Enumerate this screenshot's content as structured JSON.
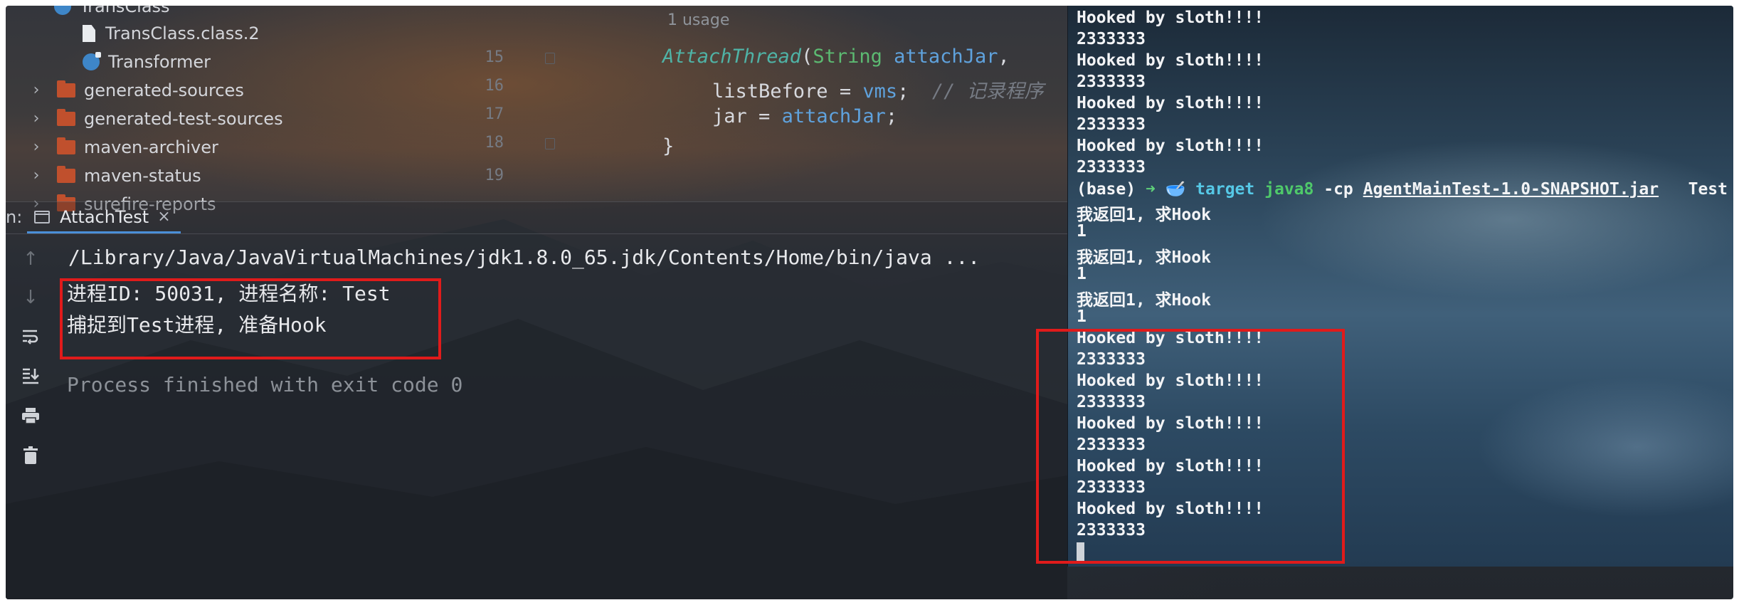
{
  "project_tree": {
    "items": [
      {
        "label": "TransClass",
        "kind": "class"
      },
      {
        "label": "TransClass.class.2",
        "kind": "file"
      },
      {
        "label": "Transformer",
        "kind": "class"
      },
      {
        "label": "generated-sources",
        "kind": "folder"
      },
      {
        "label": "generated-test-sources",
        "kind": "folder"
      },
      {
        "label": "maven-archiver",
        "kind": "folder"
      },
      {
        "label": "maven-status",
        "kind": "folder"
      },
      {
        "label": "surefire-reports",
        "kind": "folder"
      }
    ]
  },
  "editor": {
    "usage_hint": "1 usage",
    "line_numbers": [
      "15",
      "16",
      "17",
      "18",
      "19"
    ],
    "lines": {
      "l15": {
        "method": "AttachThread",
        "open": "(",
        "type": "String",
        "param": "attachJar",
        "tail": ","
      },
      "l16": {
        "var": "listBefore",
        "eq": " = ",
        "value": "vms",
        "semi": ";",
        "comment": "// 记录程序"
      },
      "l17": {
        "var": "jar",
        "eq": " = ",
        "value": "attachJar",
        "semi": ";"
      },
      "l18": {
        "text": "}"
      }
    }
  },
  "run_window": {
    "label": "n:",
    "tab_label": "AttachTest",
    "console": {
      "command": "/Library/Java/JavaVirtualMachines/jdk1.8.0_65.jdk/Contents/Home/bin/java ...",
      "lines": [
        "进程ID: 50031, 进程名称: Test",
        "捕捉到Test进程, 准备Hook"
      ],
      "exit_message": "Process finished with exit code 0"
    },
    "toolbar_icons": [
      "arrow-up-icon",
      "arrow-down-icon",
      "soft-wrap-icon",
      "scroll-to-end-icon",
      "print-icon",
      "trash-icon"
    ]
  },
  "terminal": {
    "lines_before": [
      "Hooked by sloth!!!!",
      "2333333",
      "Hooked by sloth!!!!",
      "2333333",
      "Hooked by sloth!!!!",
      "2333333",
      "Hooked by sloth!!!!",
      "2333333"
    ],
    "prompt": {
      "env": "(base)",
      "arrow": "➜",
      "icon": "🥣",
      "dir": "target",
      "cmd": "java8",
      "flag": "-cp",
      "jar": "AgentMainTest-1.0-SNAPSHOT.jar",
      "arg": "Test"
    },
    "output": [
      "我返回1, 求Hook",
      "1",
      "我返回1, 求Hook",
      "1",
      "我返回1, 求Hook",
      "1"
    ],
    "hooked": [
      "Hooked by sloth!!!!",
      "2333333",
      "Hooked by sloth!!!!",
      "2333333",
      "Hooked by sloth!!!!",
      "2333333",
      "Hooked by sloth!!!!",
      "2333333",
      "Hooked by sloth!!!!",
      "2333333"
    ]
  },
  "colors": {
    "highlight": "#e01b1b",
    "accent": "#4b8fd8"
  }
}
